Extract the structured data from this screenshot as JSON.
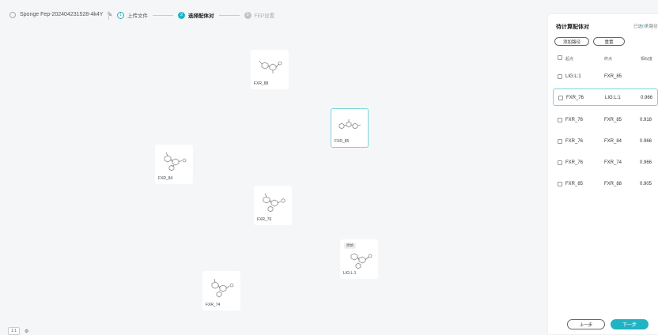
{
  "header": {
    "project_name": "Sponge Fep-20240423152​8-4k4Y",
    "steps": [
      {
        "num": "1",
        "label": "上传文件"
      },
      {
        "num": "2",
        "label": "选择配体对"
      },
      {
        "num": "3",
        "label": "FEP设置"
      }
    ]
  },
  "graph": {
    "nodes": [
      {
        "label": "FXR_88"
      },
      {
        "label": "FXR_85"
      },
      {
        "label": "FXR_84"
      },
      {
        "label": "FXR_76"
      },
      {
        "label": "LIG:L:1",
        "badge": "原始"
      },
      {
        "label": "FXR_74"
      }
    ]
  },
  "footer": {
    "zoom": "1:1"
  },
  "panel": {
    "title": "待计算配体对",
    "selected_prefix": "已选",
    "selected_count": "0",
    "selected_suffix": "条路径",
    "add_path_label": "添加路径",
    "reset_label": "重置",
    "columns": [
      "起点",
      "终点",
      "相似度"
    ],
    "rows": [
      {
        "start": "LIG:L:1",
        "end": "FXR_85",
        "similarity": ""
      },
      {
        "start": "FXR_76",
        "end": "LIG:L:1",
        "similarity": "0.966"
      },
      {
        "start": "FXR_76",
        "end": "FXR_85",
        "similarity": "0.918"
      },
      {
        "start": "FXR_76",
        "end": "FXR_84",
        "similarity": "0.966"
      },
      {
        "start": "FXR_76",
        "end": "FXR_74",
        "similarity": "0.966"
      },
      {
        "start": "FXR_85",
        "end": "FXR_88",
        "similarity": "0.905"
      }
    ],
    "prev_label": "上一步",
    "next_label": "下一步"
  }
}
